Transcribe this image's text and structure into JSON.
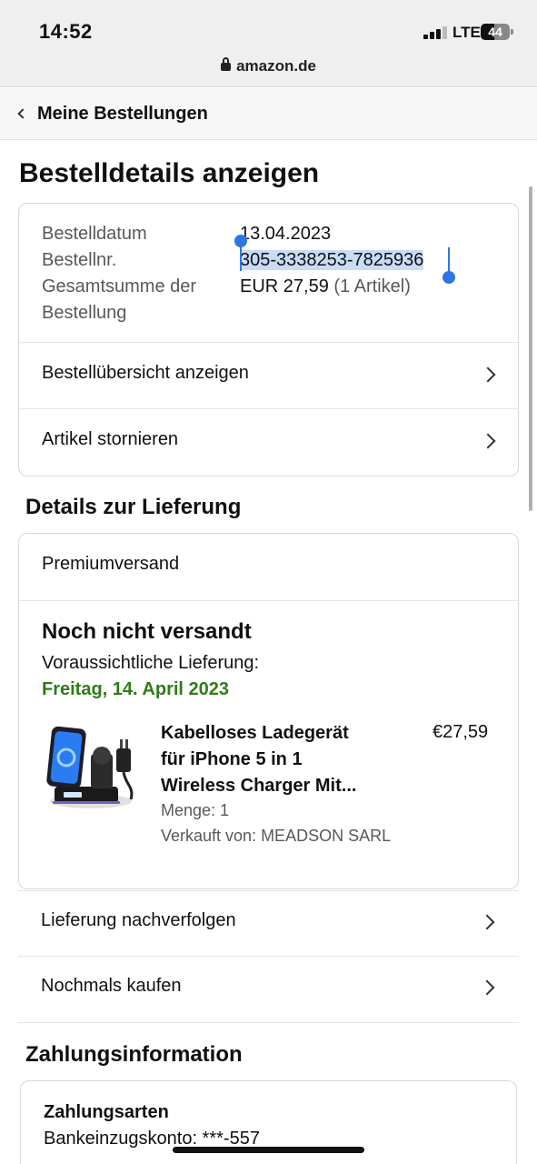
{
  "status_bar": {
    "time": "14:52",
    "network": "LTE",
    "battery": "44"
  },
  "url_bar": {
    "domain": "amazon.de",
    "lock_icon": "lock-icon"
  },
  "nav": {
    "back_label": "Meine Bestellungen",
    "back_icon": "chevron-left-icon"
  },
  "page_title": "Bestelldetails anzeigen",
  "order_info": {
    "date_label": "Bestelldatum",
    "date_value": "13.04.2023",
    "number_label": "Bestellnr.",
    "number_value": "305-3338253-7825936",
    "total_label_line1": "Gesamtsumme der",
    "total_label_line2": "Bestellung",
    "total_value": "EUR 27,59",
    "total_items": "(1 Artikel)",
    "selection_color": "#c9dcf5",
    "handle_color": "#2f76e4"
  },
  "order_actions": [
    {
      "label": "Bestellübersicht anzeigen"
    },
    {
      "label": "Artikel stornieren"
    }
  ],
  "delivery": {
    "heading": "Details zur Lieferung",
    "shipping_method": "Premiumversand",
    "status": "Noch nicht versandt",
    "expected_label": "Voraussichtliche Lieferung:",
    "expected_date": "Freitag, 14. April 2023",
    "date_color": "#2f7b1a",
    "item": {
      "title_line1": "Kabelloses Ladegerät",
      "title_line2": "für iPhone 5 in 1",
      "title_line3": "Wireless Charger Mit...",
      "price": "€27,59",
      "quantity": "Menge: 1",
      "seller": "Verkauft von: MEADSON SARL",
      "image_icon": "wireless-charger-product-image"
    }
  },
  "delivery_actions": [
    {
      "label": "Lieferung nachverfolgen"
    },
    {
      "label": "Nochmals kaufen"
    }
  ],
  "payment": {
    "heading": "Zahlungsinformation",
    "methods_label": "Zahlungsarten",
    "account": "Bankeinzugskonto: ***-557"
  }
}
